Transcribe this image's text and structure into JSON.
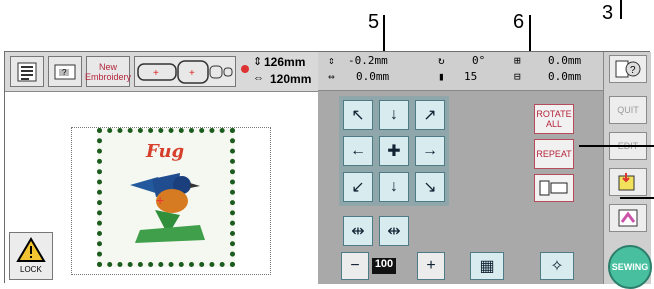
{
  "callouts": {
    "c5": "5",
    "c6": "6",
    "c3": "3"
  },
  "header": {
    "new_embroidery_line1": "New",
    "new_embroidery_line2": "Embroidery",
    "height_value": "126mm",
    "width_value": "120mm"
  },
  "info": {
    "x_offset": "-0.2mm",
    "y_offset": "0.0mm",
    "angle": "0°",
    "thread_count": "15",
    "v_spacing": "0.0mm",
    "h_spacing": "0.0mm"
  },
  "preview": {
    "design_text": "Fug"
  },
  "lock_label": "LOCK",
  "buttons": {
    "rotate": "ROTATE ALL",
    "repeat": "REPEAT",
    "size_value": "100",
    "minus": "−",
    "plus": "+"
  },
  "sidebar": {
    "quit": "QUIT",
    "edit": "EDIT",
    "sewing": "SEWING"
  },
  "colors": {
    "lcd_bg": "#cfcfcf",
    "panel_bg": "#a9a9a9",
    "button_accent": "#b3263b",
    "sewing_button": "#48c0a0"
  }
}
